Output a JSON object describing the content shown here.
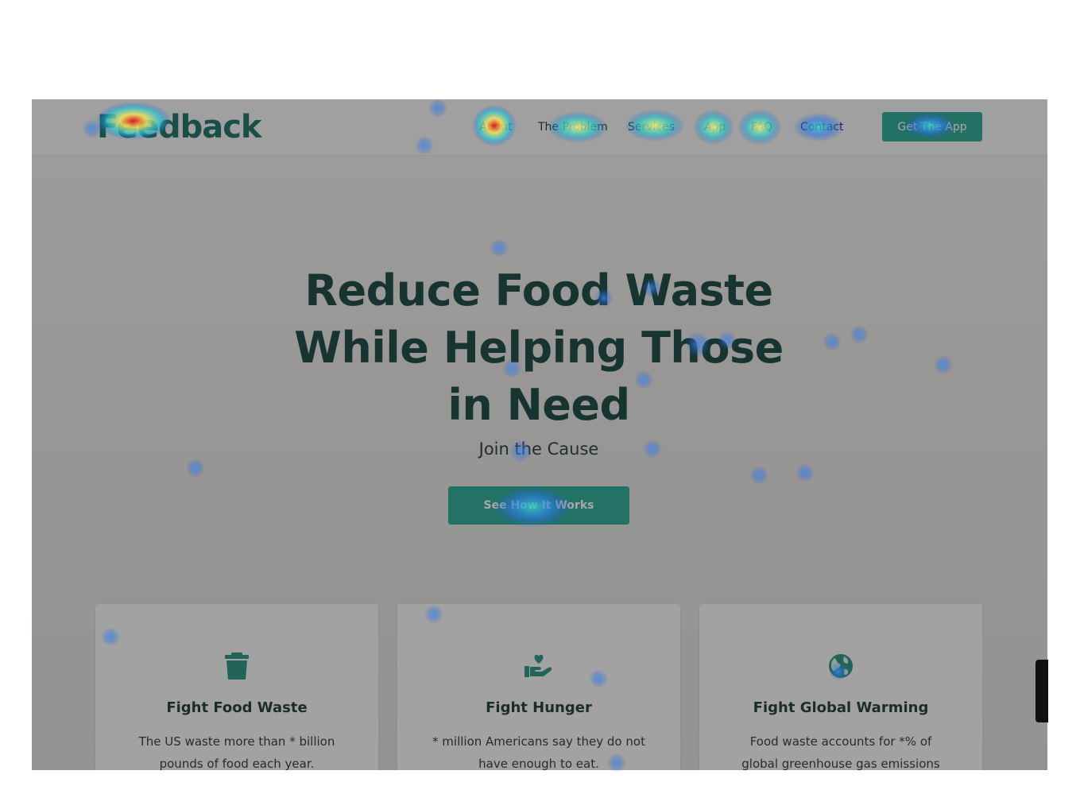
{
  "brand": {
    "logo_text": "Feedback",
    "accent": "#20a18d",
    "dark": "#0c3d36"
  },
  "nav": {
    "links": [
      "About",
      "The Problem",
      "Services",
      "App",
      "FAQ",
      "Contact"
    ],
    "cta_label": "Get The App"
  },
  "hero": {
    "title_lines": [
      "Reduce Food Waste",
      "While Helping Those",
      "in Need"
    ],
    "subtitle": "Join the Cause",
    "button_label": "See How It Works"
  },
  "features": [
    {
      "icon": "trash-icon",
      "title": "Fight Food Waste",
      "text": "The US waste more than * billion pounds of food each year."
    },
    {
      "icon": "hand-heart-icon",
      "title": "Fight Hunger",
      "text": "* million Americans say they do not have enough to eat."
    },
    {
      "icon": "globe-icon",
      "title": "Fight Global Warming",
      "text": "Food waste accounts for *% of global greenhouse gas emissions each year."
    }
  ]
}
